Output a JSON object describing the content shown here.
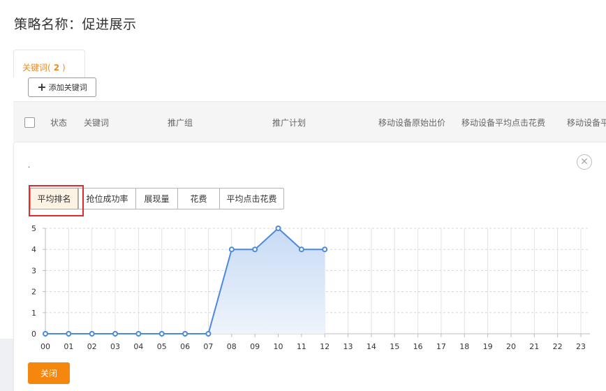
{
  "page": {
    "title": "策略名称：促进展示"
  },
  "tab": {
    "label": "关键词(",
    "count": "2",
    "close": ")"
  },
  "toolbar": {
    "add_keyword": "添加关键词"
  },
  "table": {
    "columns": [
      "状态",
      "关键词",
      "推广组",
      "推广计划",
      "移动设备原始出价",
      "移动设备平均点击花费",
      "移动设备平"
    ]
  },
  "panel": {
    "dot": ".",
    "metric_tabs": [
      "平均排名",
      "抢位成功率",
      "展现量",
      "花费",
      "平均点击花费"
    ],
    "active_tab": "平均排名",
    "close_label": "关闭"
  },
  "chart_data": {
    "type": "area",
    "title": "",
    "xlabel": "",
    "ylabel": "",
    "x": [
      "00",
      "01",
      "02",
      "03",
      "04",
      "05",
      "06",
      "07",
      "08",
      "09",
      "10",
      "11",
      "12",
      "13",
      "14",
      "15",
      "16",
      "17",
      "18",
      "19",
      "20",
      "21",
      "22",
      "23"
    ],
    "series": [
      {
        "values": [
          0,
          0,
          0,
          0,
          0,
          0,
          0,
          0,
          4,
          4,
          5,
          4,
          4
        ]
      }
    ],
    "y_ticks": [
      "0",
      "1",
      "2",
      "3",
      "4",
      "5"
    ],
    "ylim": [
      0,
      5
    ],
    "grid": true,
    "colors": {
      "line": "#4a89dc",
      "fill_top": "#c7dbf5",
      "fill_bottom": "#eef4fc"
    }
  }
}
